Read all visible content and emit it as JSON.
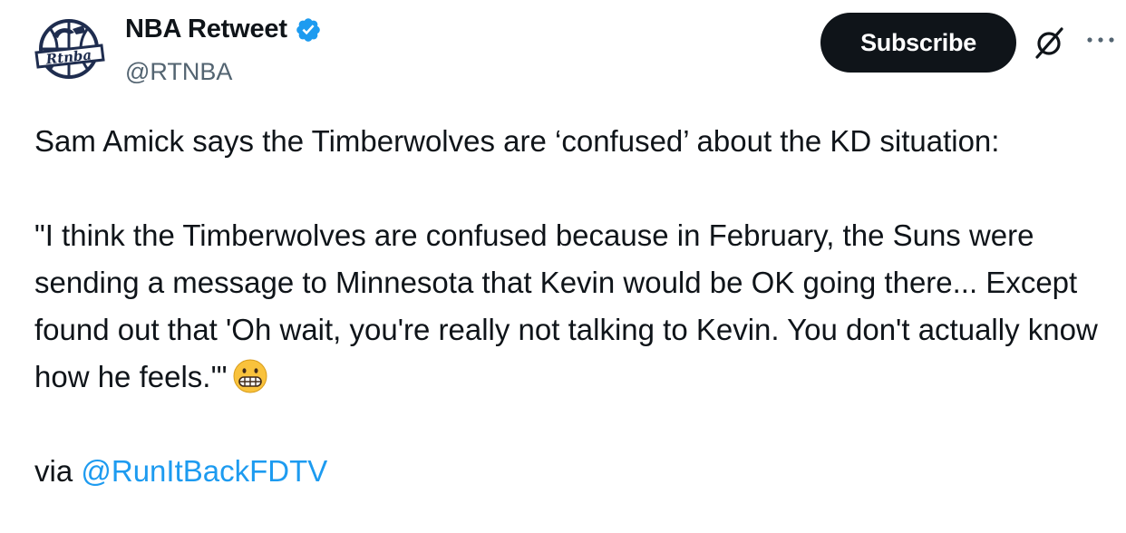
{
  "author": {
    "display_name": "NBA Retweet",
    "handle": "@RTNBA",
    "verified": true,
    "avatar_text": "Rtnba"
  },
  "actions": {
    "subscribe_label": "Subscribe",
    "grok_icon": "grok-icon",
    "more_icon": "more-icon"
  },
  "tweet": {
    "line1": "Sam Amick says the Timberwolves are ‘confused’ about the KD situation:",
    "quote": "\"I think the Timberwolves are confused because in February, the Suns were sending a message to Minnesota that Kevin would be OK going there... Except found out that 'Oh wait, you're really not talking to Kevin. You don't actually know how he feels.'\"",
    "emoji": "grimacing-face",
    "via_prefix": "via ",
    "via_mention": "@RunItBackFDTV"
  },
  "colors": {
    "text": "#0f1419",
    "secondary": "#536471",
    "link": "#1d9bf0",
    "verified": "#1d9bf0",
    "button_bg": "#0f1419",
    "button_text": "#ffffff",
    "avatar_navy": "#1f2d4f"
  }
}
